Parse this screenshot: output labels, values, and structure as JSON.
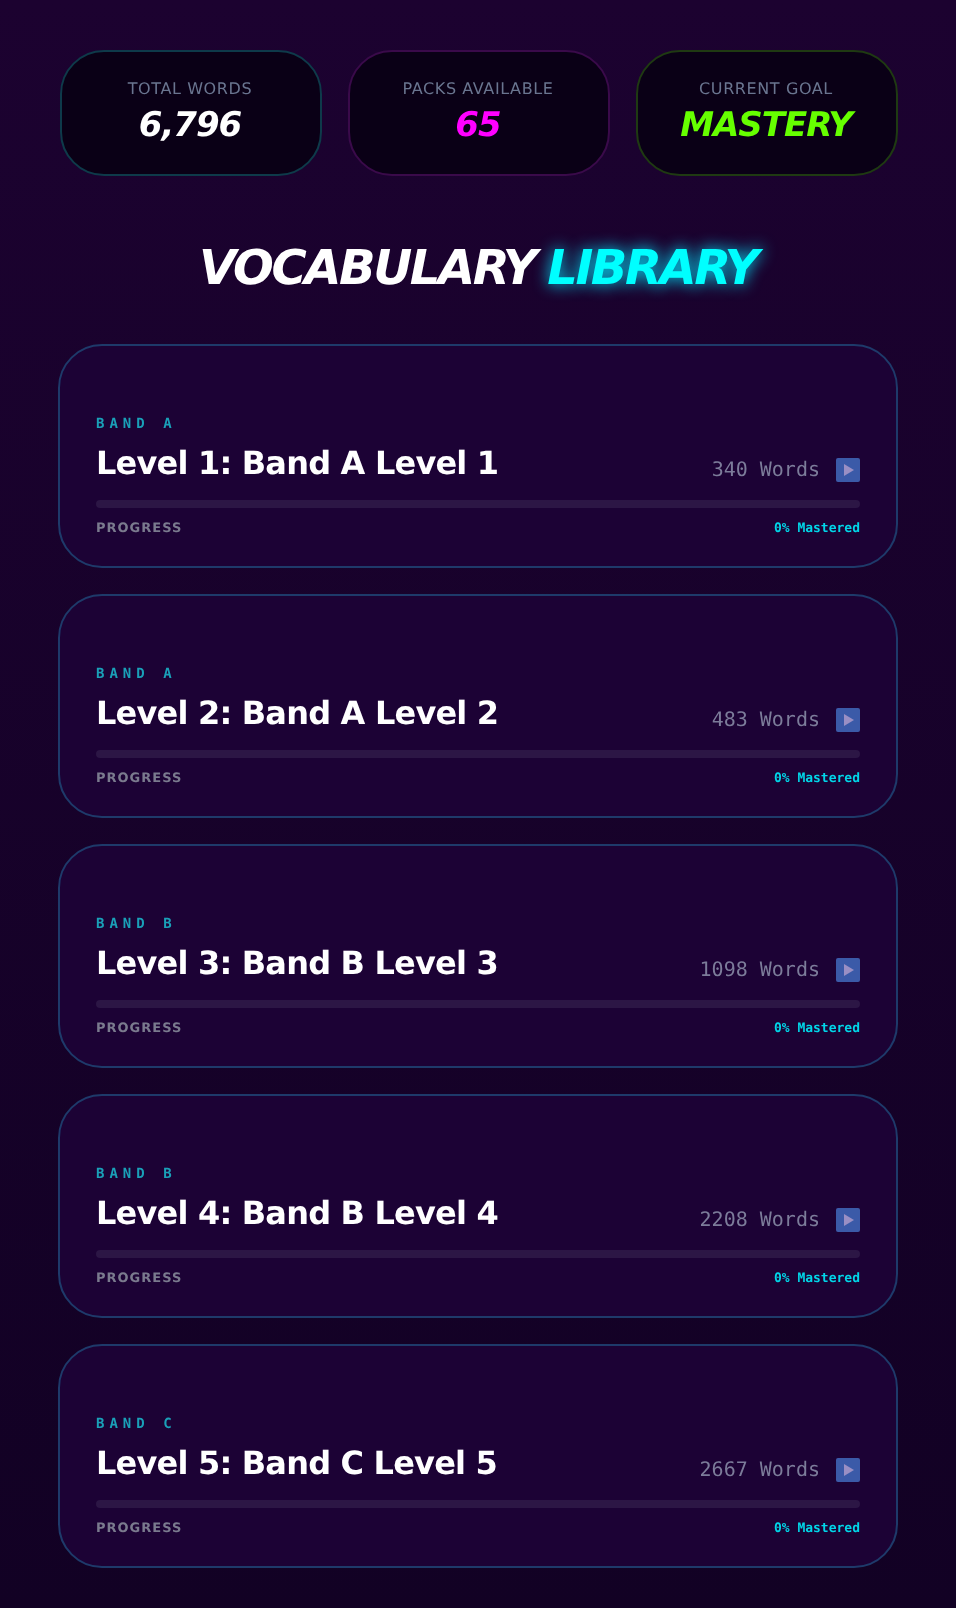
{
  "stats": [
    {
      "label": "TOTAL WORDS",
      "value": "6,796",
      "color": "#ffffff"
    },
    {
      "label": "PACKS AVAILABLE",
      "value": "65",
      "color": "#ff00ff"
    },
    {
      "label": "CURRENT GOAL",
      "value": "MASTERY",
      "color": "#66ff00"
    }
  ],
  "title": {
    "main": "VOCABULARY",
    "accent": "LIBRARY"
  },
  "packs": [
    {
      "band": "BAND A",
      "name": "Level 1: Band A Level 1",
      "count": "340 Words",
      "progress_label": "PROGRESS",
      "level": 0,
      "mastered": "0% Mastered"
    },
    {
      "band": "BAND A",
      "name": "Level 2: Band A Level 2",
      "count": "483 Words",
      "progress_label": "PROGRESS",
      "level": 0,
      "mastered": "0% Mastered"
    },
    {
      "band": "BAND B",
      "name": "Level 3: Band B Level 3",
      "count": "1098 Words",
      "progress_label": "PROGRESS",
      "level": 0,
      "mastered": "0% Mastered"
    },
    {
      "band": "BAND B",
      "name": "Level 4: Band B Level 4",
      "count": "2208 Words",
      "progress_label": "PROGRESS",
      "level": 0,
      "mastered": "0% Mastered"
    },
    {
      "band": "BAND C",
      "name": "Level 5: Band C Level 5",
      "count": "2667 Words",
      "progress_label": "PROGRESS",
      "level": 0,
      "mastered": "0% Mastered"
    }
  ]
}
